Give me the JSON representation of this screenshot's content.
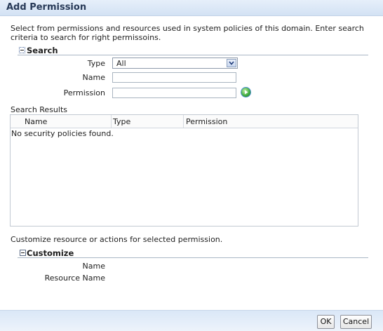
{
  "dialog": {
    "title": "Add Permission",
    "intro": "Select from permissions and resources used in system policies of this domain. Enter search criteria to search for right permissoins."
  },
  "search": {
    "heading": "Search",
    "type_label": "Type",
    "type_value": "All",
    "name_label": "Name",
    "name_value": "",
    "permission_label": "Permission",
    "permission_value": ""
  },
  "results": {
    "heading": "Search Results",
    "columns": [
      "Name",
      "Type",
      "Permission"
    ],
    "empty_message": "No security policies found."
  },
  "customize": {
    "note": "Customize resource or actions for selected permission.",
    "heading": "Customize",
    "name_label": "Name",
    "resource_name_label": "Resource Name"
  },
  "buttons": {
    "ok": "OK",
    "cancel": "Cancel"
  }
}
